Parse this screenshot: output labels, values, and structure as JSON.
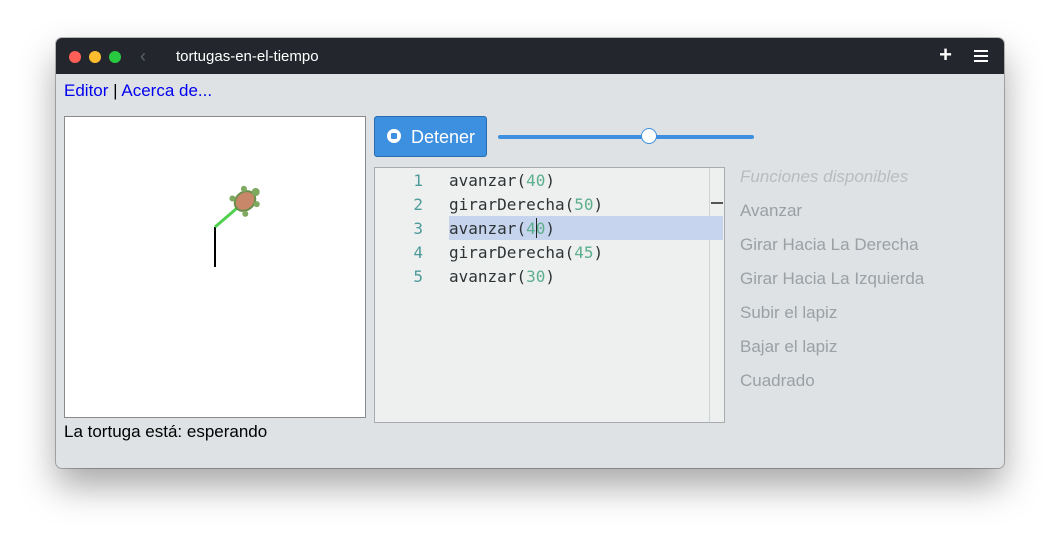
{
  "window": {
    "title": "tortugas-en-el-tiempo"
  },
  "nav": {
    "editor": "Editor",
    "separator": "|",
    "about": "Acerca de..."
  },
  "status": {
    "text": "La tortuga está: esperando"
  },
  "controls": {
    "stop_label": "Detener",
    "speed_value": 0.6
  },
  "code": {
    "lines": [
      {
        "n": "1",
        "fn": "avanzar",
        "arg": "40"
      },
      {
        "n": "2",
        "fn": "girarDerecha",
        "arg": "50"
      },
      {
        "n": "3",
        "fn": "avanzar",
        "arg": "40"
      },
      {
        "n": "4",
        "fn": "girarDerecha",
        "arg": "45"
      },
      {
        "n": "5",
        "fn": "avanzar",
        "arg": "30"
      }
    ],
    "active_line": 3
  },
  "functions": {
    "header": "Funciones disponibles",
    "items": [
      "Avanzar",
      "Girar Hacia La Derecha",
      "Girar Hacia La Izquierda",
      "Subir el lapiz",
      "Bajar el lapiz",
      "Cuadrado"
    ]
  },
  "colors": {
    "accent": "#3d8fe0",
    "path_done": "#000000",
    "path_active": "#4fd14f",
    "turtle": "#c9876a"
  }
}
